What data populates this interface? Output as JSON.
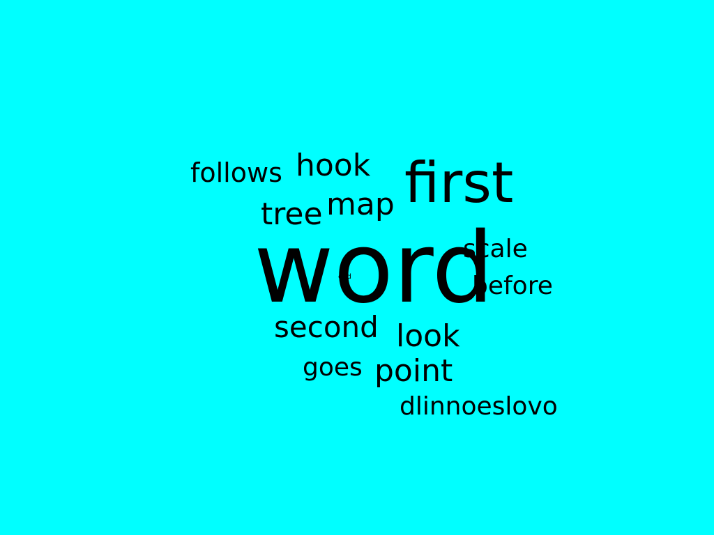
{
  "background_color": "#00ffff",
  "text_color": "#000000",
  "words": {
    "word": "word",
    "first": "first",
    "hook": "hook",
    "follows": "follows",
    "map": "map",
    "tree": "tree",
    "scale": "scale",
    "before": "before",
    "end": "end",
    "second": "second",
    "look": "look",
    "goes": "goes",
    "point": "point",
    "dlinnoeslovo": "dlinnoeslovo"
  }
}
